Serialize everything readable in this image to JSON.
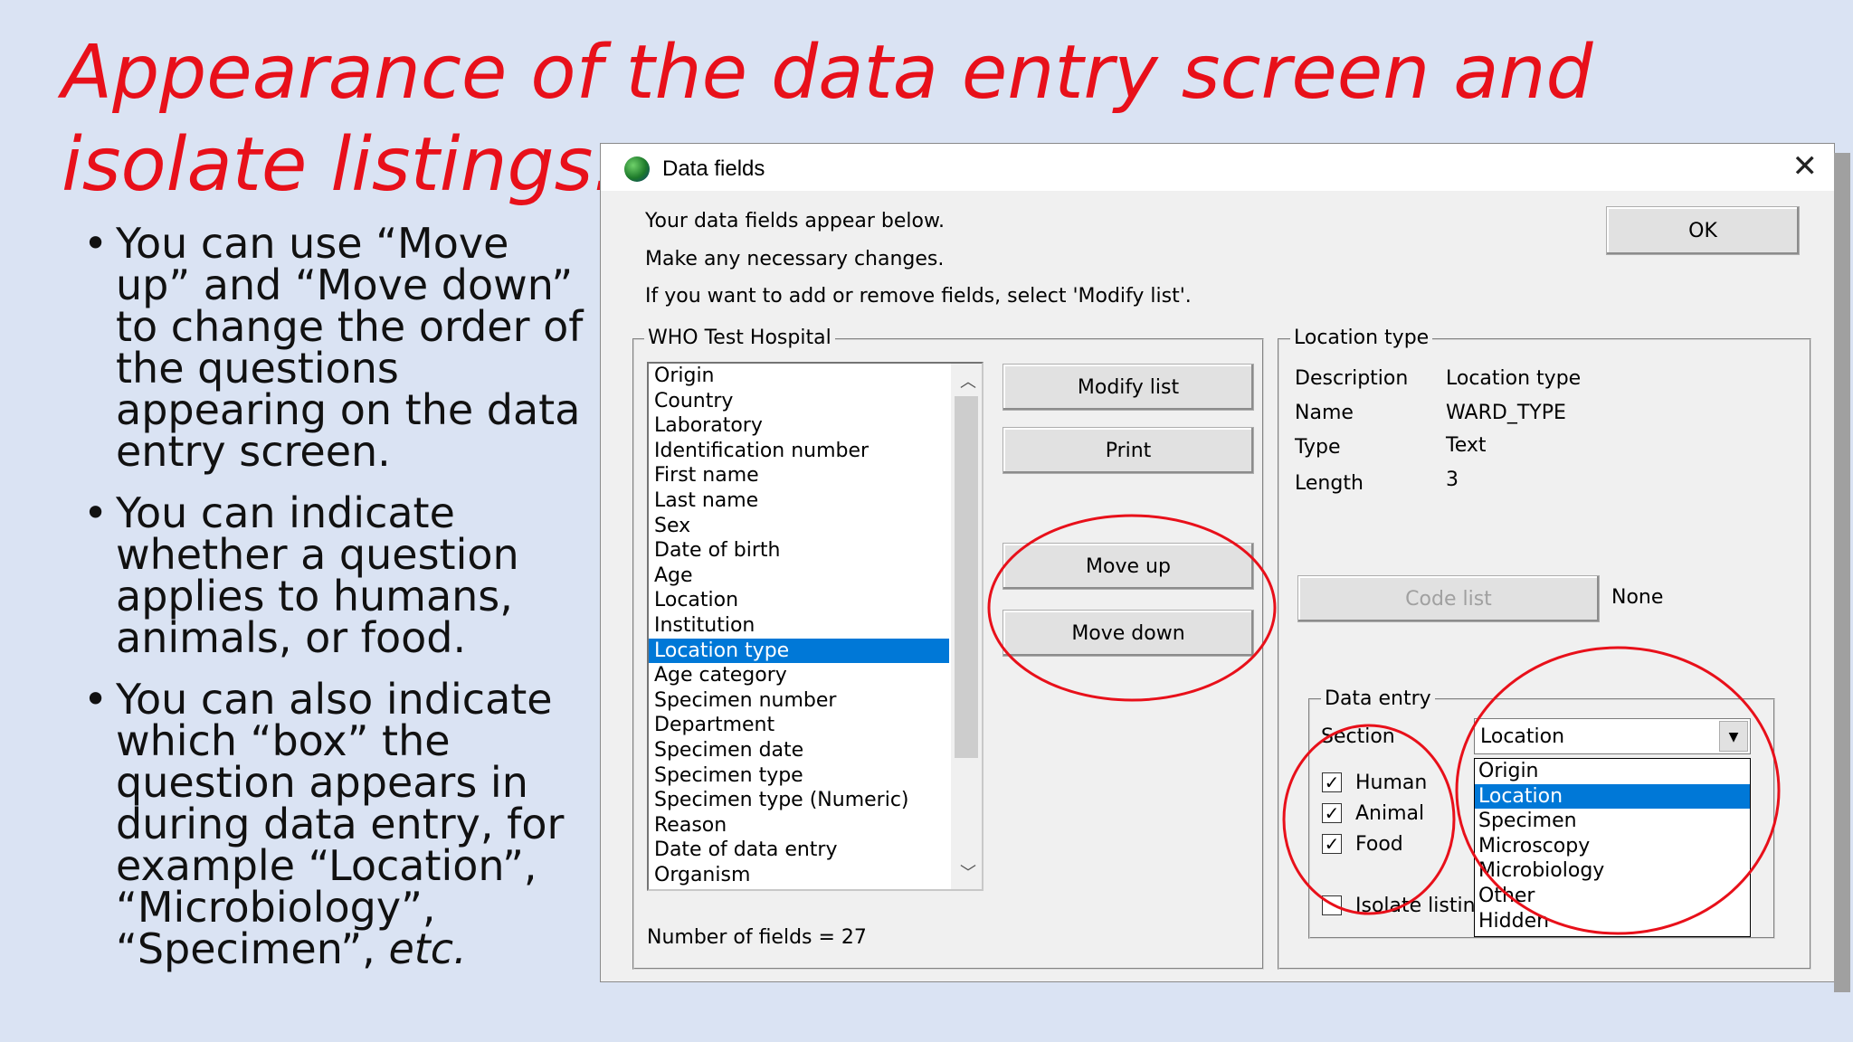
{
  "slide": {
    "title": "Appearance of the data entry screen and isolate listings:",
    "bullets": [
      {
        "text": "You can use “Move up” and “Move down” to change the order of the questions appearing on the data entry screen."
      },
      {
        "text": "You can indicate whether a question applies to humans, animals, or food."
      },
      {
        "text": "You can also indicate which “box” the question appears in during data entry, for example “Location”, “Microbiology”, “Specimen”, ",
        "emph": "etc."
      }
    ]
  },
  "dialog": {
    "title": "Data fields",
    "close_label": "✕",
    "intro": [
      "Your data fields appear below.",
      "Make any necessary changes.",
      "If you want to add or remove fields, select 'Modify list'."
    ],
    "ok_label": "OK",
    "fields_group": {
      "label": "WHO Test Hospital",
      "items": [
        "Origin",
        "Country",
        "Laboratory",
        "Identification number",
        "First name",
        "Last name",
        "Sex",
        "Date of birth",
        "Age",
        "Location",
        "Institution",
        "Location type",
        "Age category",
        "Specimen number",
        "Department",
        "Specimen date",
        "Specimen type",
        "Specimen type (Numeric)",
        "Reason",
        "Date of data entry",
        "Organism"
      ],
      "selected_item": "Location type",
      "count_text": "Number of fields = 27"
    },
    "buttons": {
      "modify_list": "Modify list",
      "print": "Print",
      "move_up": "Move up",
      "move_down": "Move down",
      "code_list": "Code list"
    },
    "details_group": {
      "label": "Location type",
      "rows": [
        {
          "label": "Description",
          "value": "Location type"
        },
        {
          "label": "Name",
          "value": "WARD_TYPE"
        },
        {
          "label": "Type",
          "value": "Text"
        },
        {
          "label": "Length",
          "value": "3"
        }
      ],
      "code_list_value": "None"
    },
    "data_entry_group": {
      "label": "Data entry",
      "section_label": "Section",
      "checkboxes": [
        {
          "label": "Human",
          "checked": true
        },
        {
          "label": "Animal",
          "checked": true
        },
        {
          "label": "Food",
          "checked": true
        }
      ],
      "isolate_listing_label": "Isolate listing",
      "section_value": "Location",
      "section_options": [
        "Origin",
        "Location",
        "Specimen",
        "Microscopy",
        "Microbiology",
        "Other",
        "Hidden"
      ],
      "selected_option": "Location"
    }
  },
  "colors": {
    "slide_bg": "#dae3f3",
    "title_red": "#e8101a",
    "annotation_red": "#e8101a",
    "selection_blue": "#0078d7"
  }
}
